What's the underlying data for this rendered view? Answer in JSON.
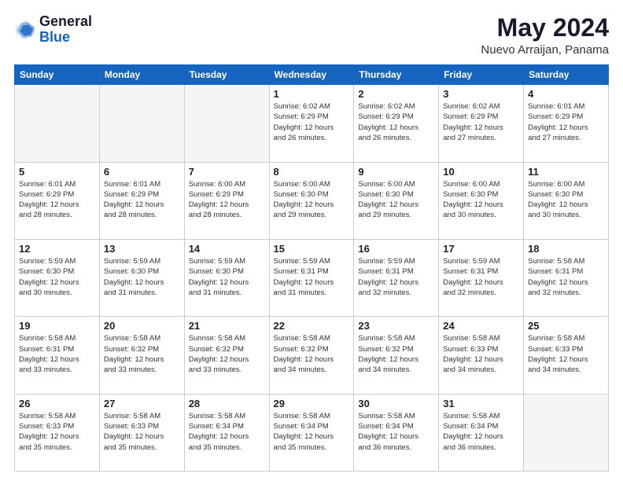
{
  "header": {
    "logo_line1": "General",
    "logo_line2": "Blue",
    "month_title": "May 2024",
    "location": "Nuevo Arraijan, Panama"
  },
  "day_headers": [
    "Sunday",
    "Monday",
    "Tuesday",
    "Wednesday",
    "Thursday",
    "Friday",
    "Saturday"
  ],
  "weeks": [
    [
      {
        "day": "",
        "info": ""
      },
      {
        "day": "",
        "info": ""
      },
      {
        "day": "",
        "info": ""
      },
      {
        "day": "1",
        "info": "Sunrise: 6:02 AM\nSunset: 6:29 PM\nDaylight: 12 hours\nand 26 minutes."
      },
      {
        "day": "2",
        "info": "Sunrise: 6:02 AM\nSunset: 6:29 PM\nDaylight: 12 hours\nand 26 minutes."
      },
      {
        "day": "3",
        "info": "Sunrise: 6:02 AM\nSunset: 6:29 PM\nDaylight: 12 hours\nand 27 minutes."
      },
      {
        "day": "4",
        "info": "Sunrise: 6:01 AM\nSunset: 6:29 PM\nDaylight: 12 hours\nand 27 minutes."
      }
    ],
    [
      {
        "day": "5",
        "info": "Sunrise: 6:01 AM\nSunset: 6:29 PM\nDaylight: 12 hours\nand 28 minutes."
      },
      {
        "day": "6",
        "info": "Sunrise: 6:01 AM\nSunset: 6:29 PM\nDaylight: 12 hours\nand 28 minutes."
      },
      {
        "day": "7",
        "info": "Sunrise: 6:00 AM\nSunset: 6:29 PM\nDaylight: 12 hours\nand 28 minutes."
      },
      {
        "day": "8",
        "info": "Sunrise: 6:00 AM\nSunset: 6:30 PM\nDaylight: 12 hours\nand 29 minutes."
      },
      {
        "day": "9",
        "info": "Sunrise: 6:00 AM\nSunset: 6:30 PM\nDaylight: 12 hours\nand 29 minutes."
      },
      {
        "day": "10",
        "info": "Sunrise: 6:00 AM\nSunset: 6:30 PM\nDaylight: 12 hours\nand 30 minutes."
      },
      {
        "day": "11",
        "info": "Sunrise: 6:00 AM\nSunset: 6:30 PM\nDaylight: 12 hours\nand 30 minutes."
      }
    ],
    [
      {
        "day": "12",
        "info": "Sunrise: 5:59 AM\nSunset: 6:30 PM\nDaylight: 12 hours\nand 30 minutes."
      },
      {
        "day": "13",
        "info": "Sunrise: 5:59 AM\nSunset: 6:30 PM\nDaylight: 12 hours\nand 31 minutes."
      },
      {
        "day": "14",
        "info": "Sunrise: 5:59 AM\nSunset: 6:30 PM\nDaylight: 12 hours\nand 31 minutes."
      },
      {
        "day": "15",
        "info": "Sunrise: 5:59 AM\nSunset: 6:31 PM\nDaylight: 12 hours\nand 31 minutes."
      },
      {
        "day": "16",
        "info": "Sunrise: 5:59 AM\nSunset: 6:31 PM\nDaylight: 12 hours\nand 32 minutes."
      },
      {
        "day": "17",
        "info": "Sunrise: 5:59 AM\nSunset: 6:31 PM\nDaylight: 12 hours\nand 32 minutes."
      },
      {
        "day": "18",
        "info": "Sunrise: 5:58 AM\nSunset: 6:31 PM\nDaylight: 12 hours\nand 32 minutes."
      }
    ],
    [
      {
        "day": "19",
        "info": "Sunrise: 5:58 AM\nSunset: 6:31 PM\nDaylight: 12 hours\nand 33 minutes."
      },
      {
        "day": "20",
        "info": "Sunrise: 5:58 AM\nSunset: 6:32 PM\nDaylight: 12 hours\nand 33 minutes."
      },
      {
        "day": "21",
        "info": "Sunrise: 5:58 AM\nSunset: 6:32 PM\nDaylight: 12 hours\nand 33 minutes."
      },
      {
        "day": "22",
        "info": "Sunrise: 5:58 AM\nSunset: 6:32 PM\nDaylight: 12 hours\nand 34 minutes."
      },
      {
        "day": "23",
        "info": "Sunrise: 5:58 AM\nSunset: 6:32 PM\nDaylight: 12 hours\nand 34 minutes."
      },
      {
        "day": "24",
        "info": "Sunrise: 5:58 AM\nSunset: 6:33 PM\nDaylight: 12 hours\nand 34 minutes."
      },
      {
        "day": "25",
        "info": "Sunrise: 5:58 AM\nSunset: 6:33 PM\nDaylight: 12 hours\nand 34 minutes."
      }
    ],
    [
      {
        "day": "26",
        "info": "Sunrise: 5:58 AM\nSunset: 6:33 PM\nDaylight: 12 hours\nand 35 minutes."
      },
      {
        "day": "27",
        "info": "Sunrise: 5:58 AM\nSunset: 6:33 PM\nDaylight: 12 hours\nand 35 minutes."
      },
      {
        "day": "28",
        "info": "Sunrise: 5:58 AM\nSunset: 6:34 PM\nDaylight: 12 hours\nand 35 minutes."
      },
      {
        "day": "29",
        "info": "Sunrise: 5:58 AM\nSunset: 6:34 PM\nDaylight: 12 hours\nand 35 minutes."
      },
      {
        "day": "30",
        "info": "Sunrise: 5:58 AM\nSunset: 6:34 PM\nDaylight: 12 hours\nand 36 minutes."
      },
      {
        "day": "31",
        "info": "Sunrise: 5:58 AM\nSunset: 6:34 PM\nDaylight: 12 hours\nand 36 minutes."
      },
      {
        "day": "",
        "info": ""
      }
    ]
  ]
}
